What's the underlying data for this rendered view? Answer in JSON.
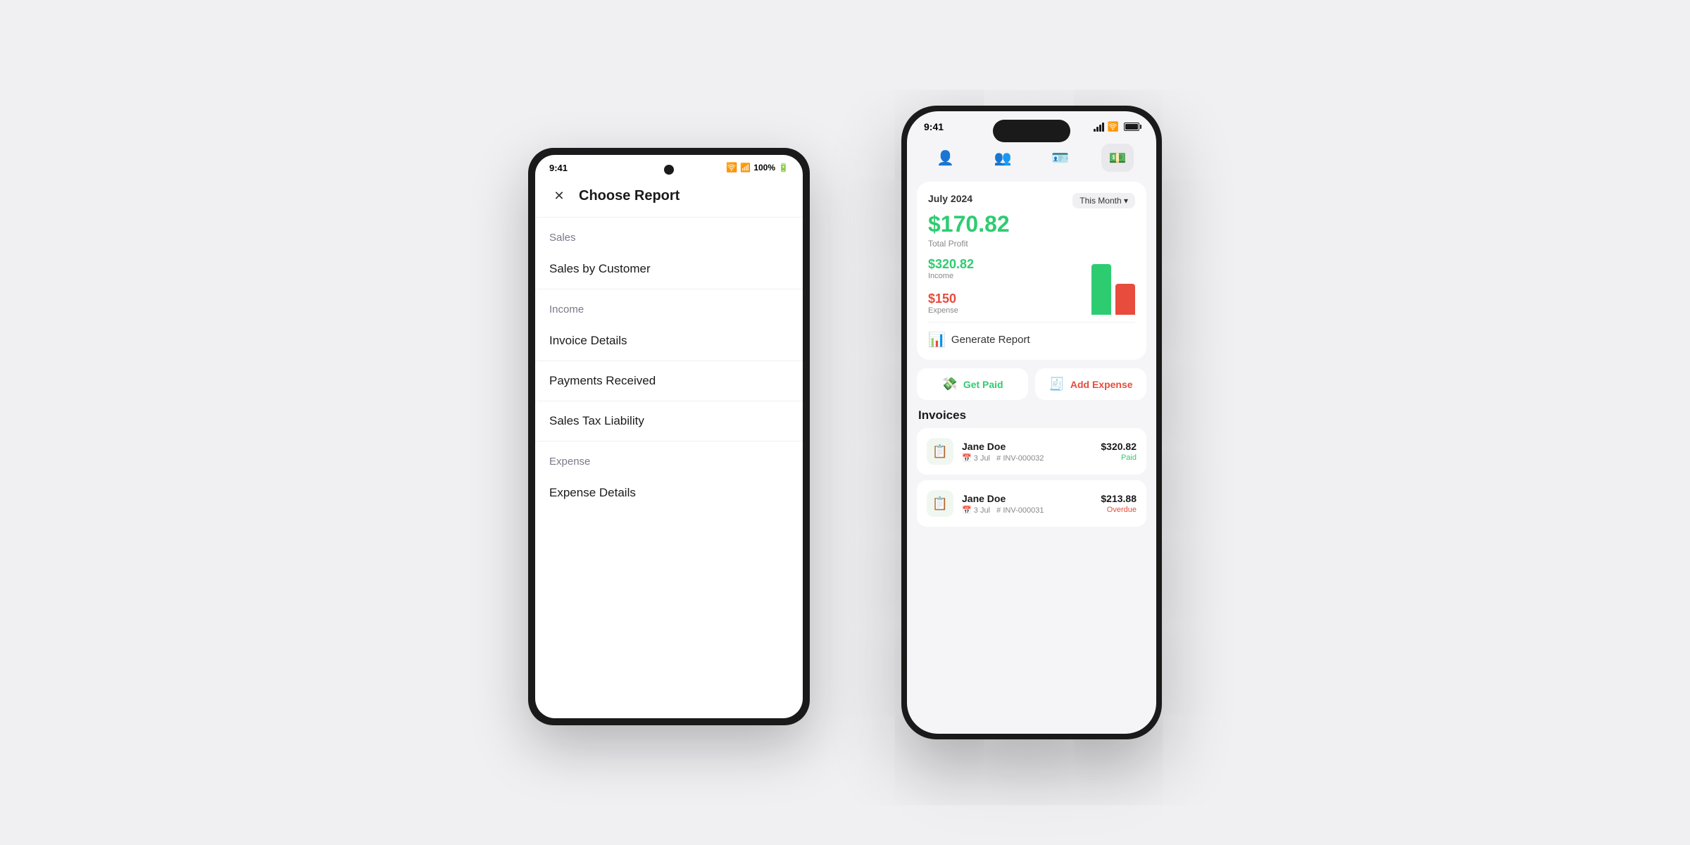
{
  "background": "#f0f0f3",
  "android": {
    "statusBar": {
      "time": "9:41",
      "wifi": "wifi",
      "signal": "signal",
      "battery": "100%"
    },
    "header": {
      "closeLabel": "✕",
      "title": "Choose Report"
    },
    "sections": [
      {
        "id": "sales",
        "header": "Sales",
        "items": [
          "Sales by Customer"
        ]
      },
      {
        "id": "income",
        "header": "Income",
        "items": [
          "Invoice Details",
          "Payments Received",
          "Sales Tax Liability"
        ]
      },
      {
        "id": "expense",
        "header": "Expense",
        "items": [
          "Expense Details"
        ]
      }
    ]
  },
  "iphone": {
    "statusBar": {
      "time": "9:41"
    },
    "tabs": [
      {
        "id": "profile",
        "icon": "👤",
        "active": false
      },
      {
        "id": "customers",
        "icon": "👥",
        "active": false
      },
      {
        "id": "invoices",
        "icon": "🪪",
        "active": false
      },
      {
        "id": "payments",
        "icon": "💵",
        "active": true
      }
    ],
    "dashboard": {
      "month": "July 2024",
      "periodLabel": "This Month ▾",
      "profit": "$170.82",
      "profitLabel": "Total Profit",
      "income": "$320.82",
      "incomeLabel": "Income",
      "expense": "$150",
      "expenseLabel": "Expense",
      "generateReport": "Generate Report"
    },
    "actions": {
      "getPaid": "Get Paid",
      "addExpense": "Add Expense"
    },
    "invoices": {
      "title": "Invoices",
      "items": [
        {
          "name": "Jane Doe",
          "amount": "$320.82",
          "date": "3 Jul",
          "invoiceNum": "INV-000032",
          "status": "Paid",
          "statusType": "paid"
        },
        {
          "name": "Jane Doe",
          "amount": "$213.88",
          "date": "3 Jul",
          "invoiceNum": "INV-000031",
          "status": "Overdue",
          "statusType": "overdue"
        }
      ]
    }
  }
}
